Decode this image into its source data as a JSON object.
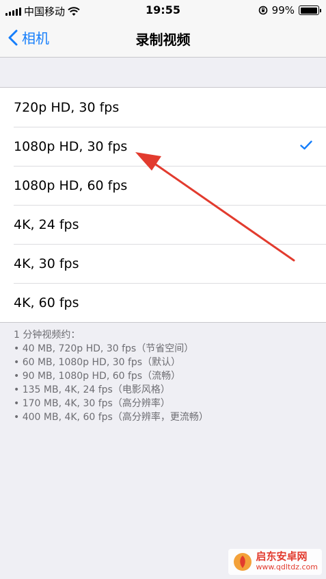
{
  "status_bar": {
    "carrier": "中国移动",
    "time": "19:55",
    "battery": "99%",
    "battery_level": 0.99
  },
  "nav": {
    "back_label": "相机",
    "title": "录制视频"
  },
  "options": [
    {
      "label": "720p HD, 30 fps",
      "selected": false
    },
    {
      "label": "1080p HD, 30 fps",
      "selected": true
    },
    {
      "label": "1080p HD, 60 fps",
      "selected": false
    },
    {
      "label": "4K, 24 fps",
      "selected": false
    },
    {
      "label": "4K, 30 fps",
      "selected": false
    },
    {
      "label": "4K, 60 fps",
      "selected": false
    }
  ],
  "footer": {
    "heading": "1 分钟视频约：",
    "lines": [
      "• 40 MB, 720p HD, 30 fps（节省空间）",
      "• 60 MB, 1080p HD, 30 fps（默认）",
      "• 90 MB, 1080p HD, 60 fps（流畅）",
      "• 135 MB, 4K, 24 fps（电影风格）",
      "• 170 MB, 4K, 30 fps（高分辨率）",
      "• 400 MB, 4K, 60 fps（高分辨率，更流畅）"
    ]
  },
  "watermark": {
    "title": "启东安卓网",
    "url": "www.qdltdz.com"
  },
  "colors": {
    "accent": "#157efb",
    "annotation_arrow": "#e23b2e",
    "background": "#efeff4"
  },
  "icons": {
    "back": "chevron-left-icon",
    "wifi": "wifi-icon",
    "rotation_lock": "rotation-lock-icon",
    "check": "checkmark-icon"
  }
}
